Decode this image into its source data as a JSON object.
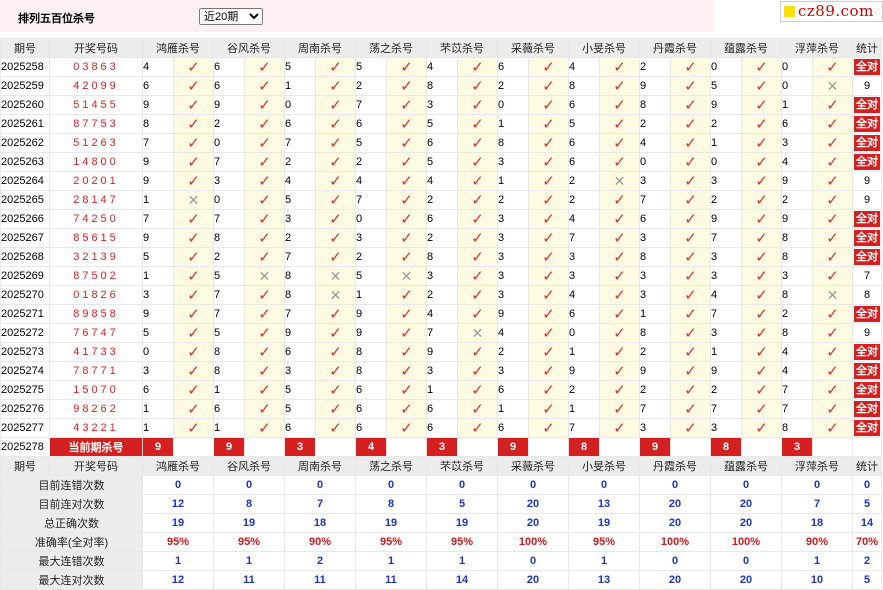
{
  "header": {
    "title": "排列五百位杀号",
    "period_select": "近20期"
  },
  "logo": {
    "text": "cz89.com"
  },
  "colors": {
    "accent_red": "#d42020",
    "check_red": "#e03030",
    "stat_blue": "#1a35c8",
    "mark_bg": "#fffbe3"
  },
  "columns": [
    "期号",
    "开奖号码",
    "鸿雁杀号",
    "谷风杀号",
    "周南杀号",
    "荡之杀号",
    "芣苡杀号",
    "采薇杀号",
    "小旻杀号",
    "丹霞杀号",
    "蕴露杀号",
    "浮萍杀号",
    "统计"
  ],
  "rows": [
    {
      "period": "2025258",
      "number": "03863",
      "vals": [
        "4",
        "6",
        "5",
        "5",
        "4",
        "6",
        "4",
        "2",
        "0",
        "0"
      ],
      "marks": [
        "ok",
        "ok",
        "ok",
        "ok",
        "ok",
        "ok",
        "ok",
        "ok",
        "ok",
        "ok"
      ],
      "stat": "全对"
    },
    {
      "period": "2025259",
      "number": "42099",
      "vals": [
        "6",
        "6",
        "1",
        "2",
        "8",
        "2",
        "8",
        "9",
        "5",
        "0"
      ],
      "marks": [
        "ok",
        "ok",
        "ok",
        "ok",
        "ok",
        "ok",
        "ok",
        "ok",
        "ok",
        "x"
      ],
      "stat": "9"
    },
    {
      "period": "2025260",
      "number": "51455",
      "vals": [
        "9",
        "9",
        "0",
        "7",
        "3",
        "0",
        "6",
        "8",
        "9",
        "1"
      ],
      "marks": [
        "ok",
        "ok",
        "ok",
        "ok",
        "ok",
        "ok",
        "ok",
        "ok",
        "ok",
        "ok"
      ],
      "stat": "全对"
    },
    {
      "period": "2025261",
      "number": "87753",
      "vals": [
        "8",
        "2",
        "6",
        "6",
        "5",
        "1",
        "5",
        "2",
        "2",
        "6"
      ],
      "marks": [
        "ok",
        "ok",
        "ok",
        "ok",
        "ok",
        "ok",
        "ok",
        "ok",
        "ok",
        "ok"
      ],
      "stat": "全对"
    },
    {
      "period": "2025262",
      "number": "51263",
      "vals": [
        "7",
        "0",
        "7",
        "5",
        "6",
        "8",
        "6",
        "4",
        "1",
        "3"
      ],
      "marks": [
        "ok",
        "ok",
        "ok",
        "ok",
        "ok",
        "ok",
        "ok",
        "ok",
        "ok",
        "ok"
      ],
      "stat": "全对"
    },
    {
      "period": "2025263",
      "number": "14800",
      "vals": [
        "9",
        "7",
        "2",
        "2",
        "5",
        "3",
        "6",
        "0",
        "0",
        "4"
      ],
      "marks": [
        "ok",
        "ok",
        "ok",
        "ok",
        "ok",
        "ok",
        "ok",
        "ok",
        "ok",
        "ok"
      ],
      "stat": "全对"
    },
    {
      "period": "2025264",
      "number": "20201",
      "vals": [
        "9",
        "3",
        "4",
        "4",
        "4",
        "1",
        "2",
        "3",
        "3",
        "9"
      ],
      "marks": [
        "ok",
        "ok",
        "ok",
        "ok",
        "ok",
        "ok",
        "x",
        "ok",
        "ok",
        "ok"
      ],
      "stat": "9"
    },
    {
      "period": "2025265",
      "number": "28147",
      "vals": [
        "1",
        "0",
        "5",
        "7",
        "2",
        "2",
        "2",
        "7",
        "2",
        "2"
      ],
      "marks": [
        "x",
        "ok",
        "ok",
        "ok",
        "ok",
        "ok",
        "ok",
        "ok",
        "ok",
        "ok"
      ],
      "stat": "9"
    },
    {
      "period": "2025266",
      "number": "74250",
      "vals": [
        "7",
        "7",
        "3",
        "0",
        "6",
        "3",
        "4",
        "6",
        "9",
        "9"
      ],
      "marks": [
        "ok",
        "ok",
        "ok",
        "ok",
        "ok",
        "ok",
        "ok",
        "ok",
        "ok",
        "ok"
      ],
      "stat": "全对"
    },
    {
      "period": "2025267",
      "number": "85615",
      "vals": [
        "9",
        "8",
        "2",
        "3",
        "2",
        "3",
        "7",
        "3",
        "7",
        "8"
      ],
      "marks": [
        "ok",
        "ok",
        "ok",
        "ok",
        "ok",
        "ok",
        "ok",
        "ok",
        "ok",
        "ok"
      ],
      "stat": "全对"
    },
    {
      "period": "2025268",
      "number": "32139",
      "vals": [
        "5",
        "2",
        "7",
        "2",
        "8",
        "3",
        "3",
        "8",
        "3",
        "8"
      ],
      "marks": [
        "ok",
        "ok",
        "ok",
        "ok",
        "ok",
        "ok",
        "ok",
        "ok",
        "ok",
        "ok"
      ],
      "stat": "全对"
    },
    {
      "period": "2025269",
      "number": "87502",
      "vals": [
        "1",
        "5",
        "8",
        "5",
        "3",
        "3",
        "3",
        "3",
        "3",
        "3"
      ],
      "marks": [
        "ok",
        "x",
        "x",
        "x",
        "ok",
        "ok",
        "ok",
        "ok",
        "ok",
        "ok"
      ],
      "stat": "7"
    },
    {
      "period": "2025270",
      "number": "01826",
      "vals": [
        "3",
        "7",
        "8",
        "1",
        "2",
        "3",
        "4",
        "3",
        "4",
        "8"
      ],
      "marks": [
        "ok",
        "ok",
        "x",
        "ok",
        "ok",
        "ok",
        "ok",
        "ok",
        "ok",
        "x"
      ],
      "stat": "8"
    },
    {
      "period": "2025271",
      "number": "89858",
      "vals": [
        "9",
        "7",
        "7",
        "9",
        "4",
        "9",
        "6",
        "1",
        "7",
        "2"
      ],
      "marks": [
        "ok",
        "ok",
        "ok",
        "ok",
        "ok",
        "ok",
        "ok",
        "ok",
        "ok",
        "ok"
      ],
      "stat": "全对"
    },
    {
      "period": "2025272",
      "number": "76747",
      "vals": [
        "5",
        "5",
        "9",
        "9",
        "7",
        "4",
        "0",
        "8",
        "3",
        "8"
      ],
      "marks": [
        "ok",
        "ok",
        "ok",
        "ok",
        "x",
        "ok",
        "ok",
        "ok",
        "ok",
        "ok"
      ],
      "stat": "9"
    },
    {
      "period": "2025273",
      "number": "41733",
      "vals": [
        "0",
        "8",
        "6",
        "8",
        "9",
        "2",
        "1",
        "2",
        "1",
        "4"
      ],
      "marks": [
        "ok",
        "ok",
        "ok",
        "ok",
        "ok",
        "ok",
        "ok",
        "ok",
        "ok",
        "ok"
      ],
      "stat": "全对"
    },
    {
      "period": "2025274",
      "number": "78771",
      "vals": [
        "3",
        "8",
        "3",
        "8",
        "3",
        "3",
        "9",
        "9",
        "9",
        "4"
      ],
      "marks": [
        "ok",
        "ok",
        "ok",
        "ok",
        "ok",
        "ok",
        "ok",
        "ok",
        "ok",
        "ok"
      ],
      "stat": "全对"
    },
    {
      "period": "2025275",
      "number": "15070",
      "vals": [
        "6",
        "1",
        "5",
        "6",
        "1",
        "6",
        "2",
        "2",
        "2",
        "7"
      ],
      "marks": [
        "ok",
        "ok",
        "ok",
        "ok",
        "ok",
        "ok",
        "ok",
        "ok",
        "ok",
        "ok"
      ],
      "stat": "全对"
    },
    {
      "period": "2025276",
      "number": "98262",
      "vals": [
        "1",
        "6",
        "5",
        "6",
        "6",
        "1",
        "1",
        "7",
        "7",
        "7"
      ],
      "marks": [
        "ok",
        "ok",
        "ok",
        "ok",
        "ok",
        "ok",
        "ok",
        "ok",
        "ok",
        "ok"
      ],
      "stat": "全对"
    },
    {
      "period": "2025277",
      "number": "43221",
      "vals": [
        "1",
        "1",
        "6",
        "6",
        "6",
        "6",
        "7",
        "3",
        "3",
        "8"
      ],
      "marks": [
        "ok",
        "ok",
        "ok",
        "ok",
        "ok",
        "ok",
        "ok",
        "ok",
        "ok",
        "ok"
      ],
      "stat": "全对"
    }
  ],
  "current": {
    "period": "2025278",
    "label": "当前期杀号",
    "vals": [
      "9",
      "9",
      "3",
      "4",
      "3",
      "9",
      "8",
      "9",
      "8",
      "3"
    ]
  },
  "check_glyph": "✓",
  "cross_glyph": "✕",
  "stats": [
    {
      "label": "目前连错次数",
      "vals": [
        "0",
        "0",
        "0",
        "0",
        "0",
        "0",
        "0",
        "0",
        "0",
        "0",
        "0"
      ]
    },
    {
      "label": "目前连对次数",
      "vals": [
        "12",
        "8",
        "7",
        "8",
        "5",
        "20",
        "13",
        "20",
        "20",
        "7",
        "5"
      ]
    },
    {
      "label": "总正确次数",
      "vals": [
        "19",
        "19",
        "18",
        "19",
        "19",
        "20",
        "19",
        "20",
        "20",
        "18",
        "14"
      ]
    },
    {
      "label": "准确率(全对率)",
      "vals": [
        "95%",
        "95%",
        "90%",
        "95%",
        "95%",
        "100%",
        "95%",
        "100%",
        "100%",
        "90%",
        "70%"
      ],
      "red": true
    },
    {
      "label": "最大连错次数",
      "vals": [
        "1",
        "1",
        "2",
        "1",
        "1",
        "0",
        "1",
        "0",
        "0",
        "1",
        "2"
      ]
    },
    {
      "label": "最大连对次数",
      "vals": [
        "12",
        "11",
        "11",
        "11",
        "14",
        "20",
        "13",
        "20",
        "20",
        "10",
        "5"
      ]
    }
  ]
}
